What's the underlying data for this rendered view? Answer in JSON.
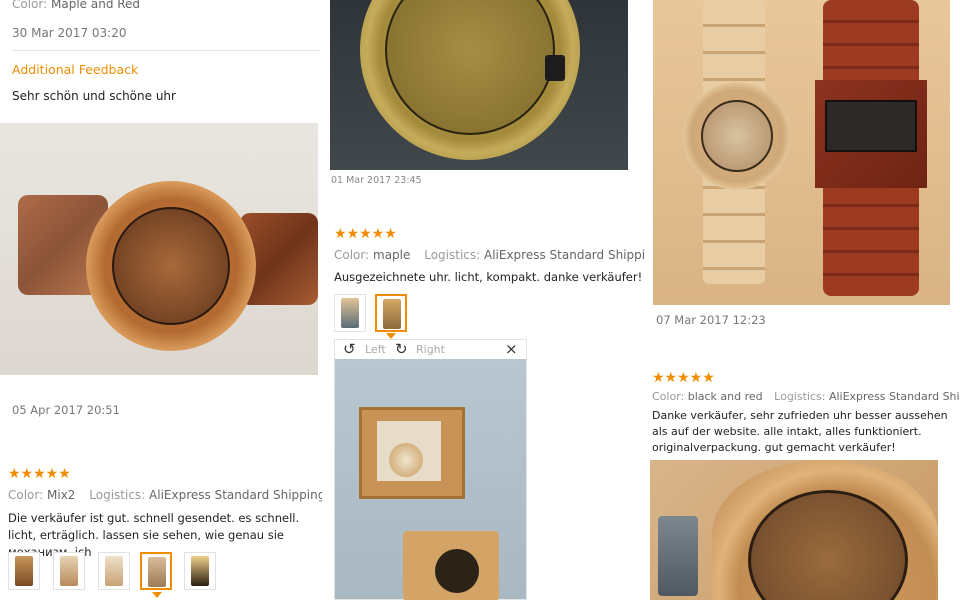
{
  "col1": {
    "color_label": "Color:",
    "color_value": "Maple and Red",
    "date_top": "30 Mar 2017 03:20",
    "additional_feedback_heading": "Additional Feedback",
    "additional_feedback_text": "Sehr schön und schöne uhr",
    "photo_date": "05 Apr 2017 20:51",
    "review": {
      "stars": "★★★★★",
      "color_label": "Color:",
      "color_value": "Mix2",
      "logistics_label": "Logistics:",
      "logistics_value": "AliExpress Standard Shipping",
      "text": "Die verkäufer ist gut. schnell gesendet. es schnell. licht, erträglich. lassen sie sehen, wie genau sie механизм. ich"
    }
  },
  "col2": {
    "photo_date": "01 Mar 2017 23:45",
    "review": {
      "stars": "★★★★★",
      "color_label": "Color:",
      "color_value": "maple",
      "logistics_label": "Logistics:",
      "logistics_value": "AliExpress Standard Shipping",
      "text": "Ausgezeichnete uhr. licht, kompakt. danke verkäufer!"
    },
    "viewer": {
      "left_label": "Left",
      "right_label": "Right",
      "close_label": "×"
    }
  },
  "col3": {
    "photo_date": "07 Mar 2017 12:23",
    "review": {
      "stars": "★★★★★",
      "color_label": "Color:",
      "color_value": "black and red",
      "logistics_label": "Logistics:",
      "logistics_value": "AliExpress Standard Shipping",
      "text": "Danke verkäufer, sehr zufrieden uhr besser aussehen als auf der website. alle intakt, alles funktioniert. originalverpackung. gut  gemacht verkäufer!"
    }
  },
  "colors": {
    "accent": "#f08c00",
    "divider": "#e5e5e5"
  },
  "icons": {
    "star": "star-icon",
    "rotate_left": "rotate-left-icon",
    "rotate_right": "rotate-right-icon",
    "close": "close-icon"
  }
}
